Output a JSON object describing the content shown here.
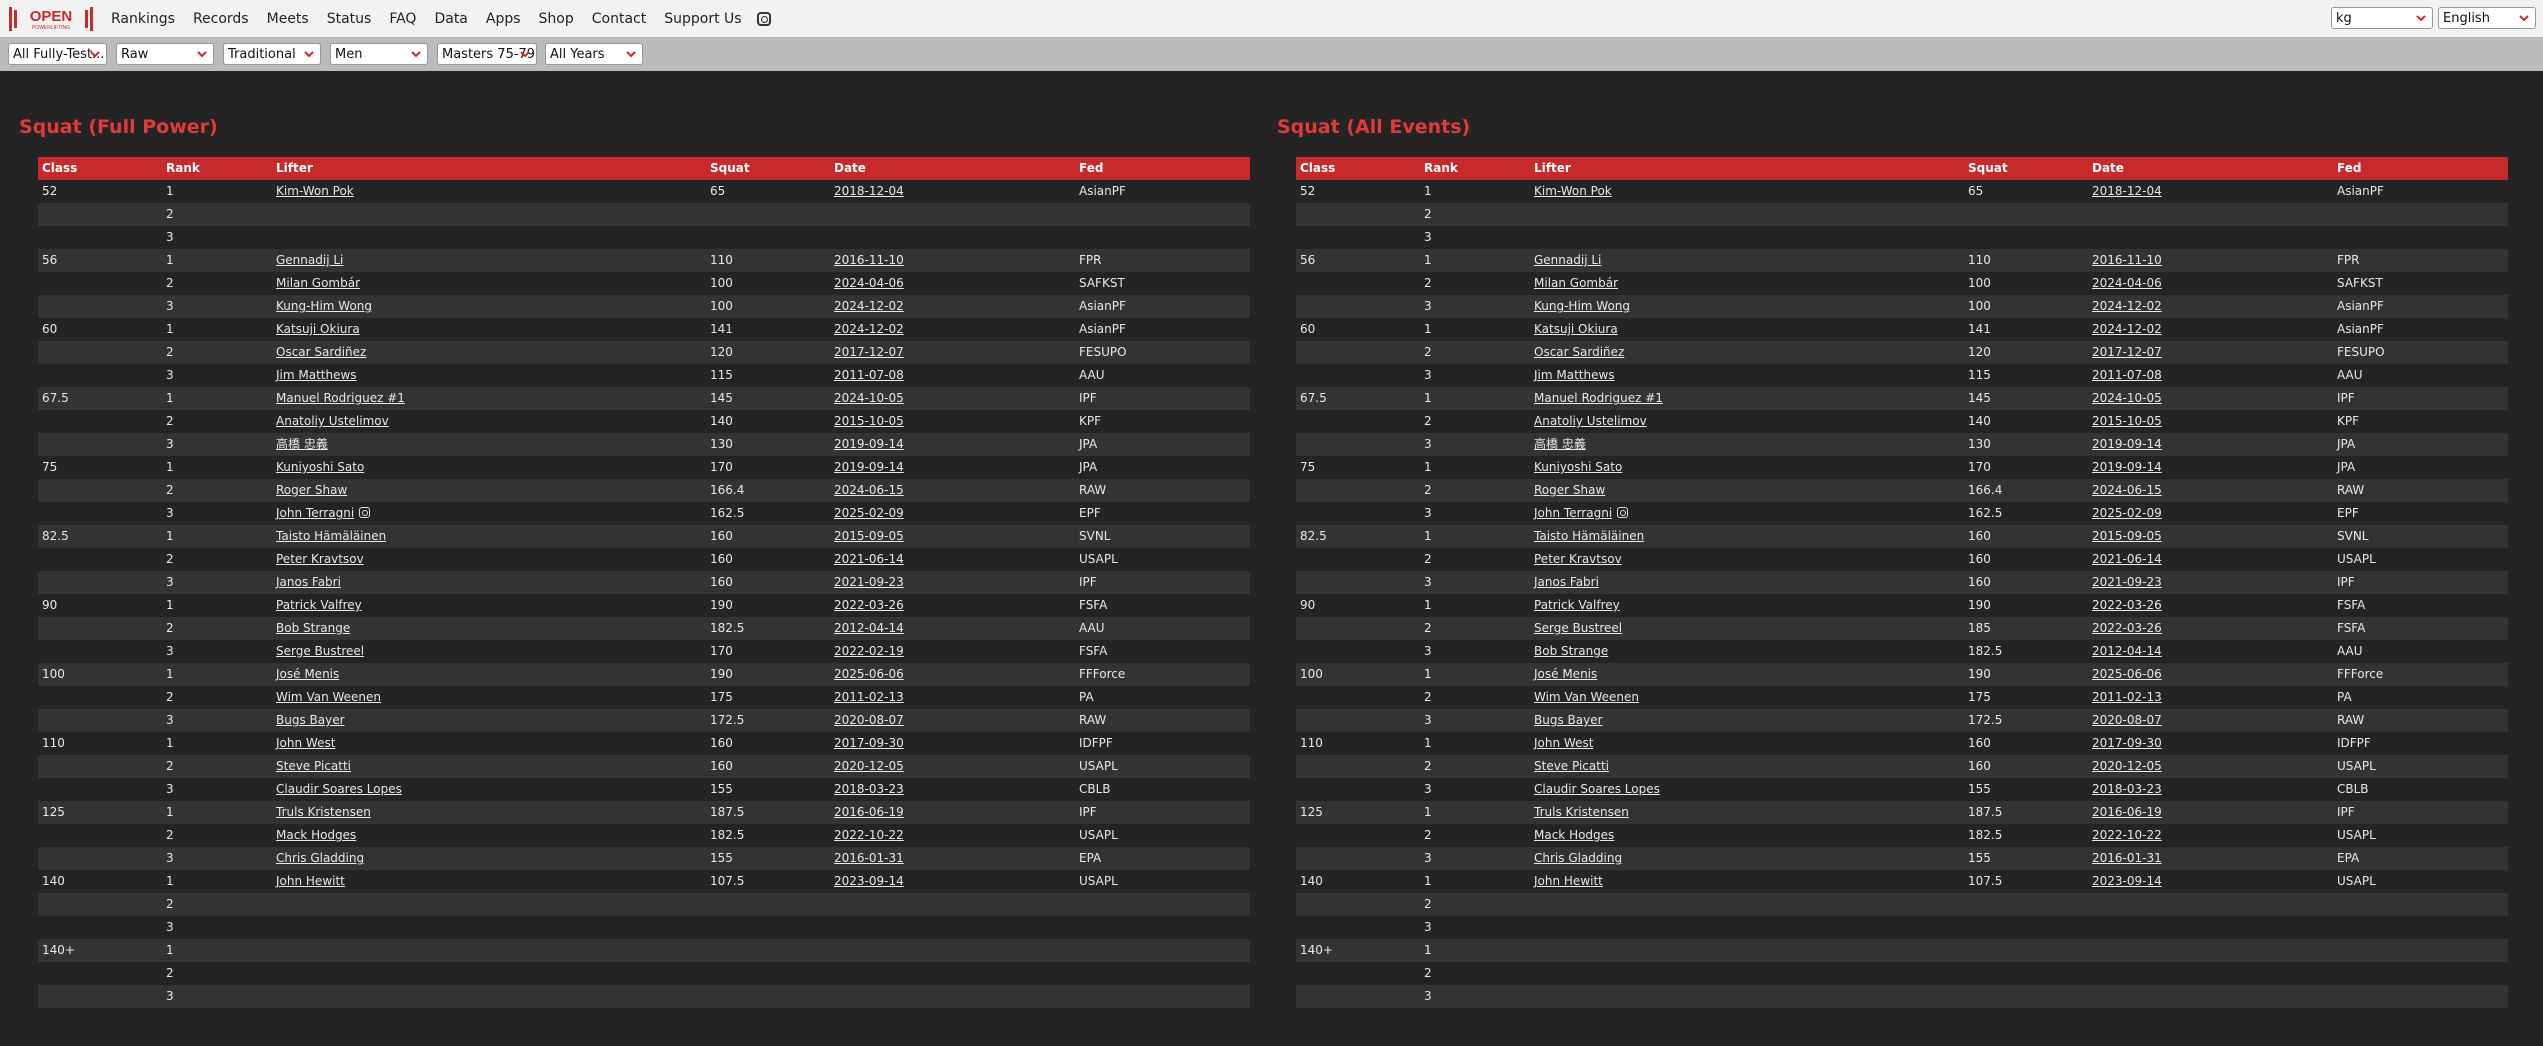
{
  "logo": {
    "main": "OPEN",
    "sub": "POWERLIFTING"
  },
  "nav": {
    "items": [
      "Rankings",
      "Records",
      "Meets",
      "Status",
      "FAQ",
      "Data",
      "Apps",
      "Shop",
      "Contact",
      "Support Us"
    ]
  },
  "units_select": "kg",
  "language_select": "English",
  "filters": [
    "All Fully-Test...",
    "Raw",
    "Traditional",
    "Men",
    "Masters 75-79",
    "All Years"
  ],
  "colors": {
    "accent": "#e03a3a",
    "header": "#c62a2a",
    "bg": "#242424",
    "row_alt": "#333333"
  },
  "columns": [
    "Class",
    "Rank",
    "Lifter",
    "Squat",
    "Date",
    "Fed"
  ],
  "panels": [
    {
      "title": "Squat (Full Power)",
      "rows": [
        {
          "class": "52",
          "rank": "1",
          "lifter": "Kim-Won Pok",
          "squat": "65",
          "date": "2018-12-04",
          "fed": "AsianPF"
        },
        {
          "class": "",
          "rank": "2",
          "lifter": "",
          "squat": "",
          "date": "",
          "fed": ""
        },
        {
          "class": "",
          "rank": "3",
          "lifter": "",
          "squat": "",
          "date": "",
          "fed": ""
        },
        {
          "class": "56",
          "rank": "1",
          "lifter": "Gennadij Li",
          "squat": "110",
          "date": "2016-11-10",
          "fed": "FPR"
        },
        {
          "class": "",
          "rank": "2",
          "lifter": "Milan Gombár",
          "squat": "100",
          "date": "2024-04-06",
          "fed": "SAFKST"
        },
        {
          "class": "",
          "rank": "3",
          "lifter": "Kung-Him Wong",
          "squat": "100",
          "date": "2024-12-02",
          "fed": "AsianPF"
        },
        {
          "class": "60",
          "rank": "1",
          "lifter": "Katsuji Okiura",
          "squat": "141",
          "date": "2024-12-02",
          "fed": "AsianPF"
        },
        {
          "class": "",
          "rank": "2",
          "lifter": "Oscar Sardiñez",
          "squat": "120",
          "date": "2017-12-07",
          "fed": "FESUPO"
        },
        {
          "class": "",
          "rank": "3",
          "lifter": "Jim Matthews",
          "squat": "115",
          "date": "2011-07-08",
          "fed": "AAU"
        },
        {
          "class": "67.5",
          "rank": "1",
          "lifter": "Manuel Rodriguez #1",
          "squat": "145",
          "date": "2024-10-05",
          "fed": "IPF"
        },
        {
          "class": "",
          "rank": "2",
          "lifter": "Anatoliy Ustelimov",
          "squat": "140",
          "date": "2015-10-05",
          "fed": "KPF"
        },
        {
          "class": "",
          "rank": "3",
          "lifter": "高橋 忠義",
          "squat": "130",
          "date": "2019-09-14",
          "fed": "JPA"
        },
        {
          "class": "75",
          "rank": "1",
          "lifter": "Kuniyoshi Sato",
          "squat": "170",
          "date": "2019-09-14",
          "fed": "JPA"
        },
        {
          "class": "",
          "rank": "2",
          "lifter": "Roger Shaw",
          "squat": "166.4",
          "date": "2024-06-15",
          "fed": "RAW"
        },
        {
          "class": "",
          "rank": "3",
          "lifter": "John Terragni",
          "squat": "162.5",
          "date": "2025-02-09",
          "fed": "EPF",
          "ig": true
        },
        {
          "class": "82.5",
          "rank": "1",
          "lifter": "Taisto Hämäläinen",
          "squat": "160",
          "date": "2015-09-05",
          "fed": "SVNL"
        },
        {
          "class": "",
          "rank": "2",
          "lifter": "Peter Kravtsov",
          "squat": "160",
          "date": "2021-06-14",
          "fed": "USAPL"
        },
        {
          "class": "",
          "rank": "3",
          "lifter": "Janos Fabri",
          "squat": "160",
          "date": "2021-09-23",
          "fed": "IPF"
        },
        {
          "class": "90",
          "rank": "1",
          "lifter": "Patrick Valfrey",
          "squat": "190",
          "date": "2022-03-26",
          "fed": "FSFA"
        },
        {
          "class": "",
          "rank": "2",
          "lifter": "Bob Strange",
          "squat": "182.5",
          "date": "2012-04-14",
          "fed": "AAU"
        },
        {
          "class": "",
          "rank": "3",
          "lifter": "Serge Bustreel",
          "squat": "170",
          "date": "2022-02-19",
          "fed": "FSFA"
        },
        {
          "class": "100",
          "rank": "1",
          "lifter": "José Menis",
          "squat": "190",
          "date": "2025-06-06",
          "fed": "FFForce"
        },
        {
          "class": "",
          "rank": "2",
          "lifter": "Wim Van Weenen",
          "squat": "175",
          "date": "2011-02-13",
          "fed": "PA"
        },
        {
          "class": "",
          "rank": "3",
          "lifter": "Bugs Bayer",
          "squat": "172.5",
          "date": "2020-08-07",
          "fed": "RAW"
        },
        {
          "class": "110",
          "rank": "1",
          "lifter": "John West",
          "squat": "160",
          "date": "2017-09-30",
          "fed": "IDFPF"
        },
        {
          "class": "",
          "rank": "2",
          "lifter": "Steve Picatti",
          "squat": "160",
          "date": "2020-12-05",
          "fed": "USAPL"
        },
        {
          "class": "",
          "rank": "3",
          "lifter": "Claudir Soares Lopes",
          "squat": "155",
          "date": "2018-03-23",
          "fed": "CBLB"
        },
        {
          "class": "125",
          "rank": "1",
          "lifter": "Truls Kristensen",
          "squat": "187.5",
          "date": "2016-06-19",
          "fed": "IPF"
        },
        {
          "class": "",
          "rank": "2",
          "lifter": "Mack Hodges",
          "squat": "182.5",
          "date": "2022-10-22",
          "fed": "USAPL"
        },
        {
          "class": "",
          "rank": "3",
          "lifter": "Chris Gladding",
          "squat": "155",
          "date": "2016-01-31",
          "fed": "EPA"
        },
        {
          "class": "140",
          "rank": "1",
          "lifter": "John Hewitt",
          "squat": "107.5",
          "date": "2023-09-14",
          "fed": "USAPL"
        },
        {
          "class": "",
          "rank": "2",
          "lifter": "",
          "squat": "",
          "date": "",
          "fed": ""
        },
        {
          "class": "",
          "rank": "3",
          "lifter": "",
          "squat": "",
          "date": "",
          "fed": ""
        },
        {
          "class": "140+",
          "rank": "1",
          "lifter": "",
          "squat": "",
          "date": "",
          "fed": ""
        },
        {
          "class": "",
          "rank": "2",
          "lifter": "",
          "squat": "",
          "date": "",
          "fed": ""
        },
        {
          "class": "",
          "rank": "3",
          "lifter": "",
          "squat": "",
          "date": "",
          "fed": ""
        }
      ]
    },
    {
      "title": "Squat (All Events)",
      "rows": [
        {
          "class": "52",
          "rank": "1",
          "lifter": "Kim-Won Pok",
          "squat": "65",
          "date": "2018-12-04",
          "fed": "AsianPF"
        },
        {
          "class": "",
          "rank": "2",
          "lifter": "",
          "squat": "",
          "date": "",
          "fed": ""
        },
        {
          "class": "",
          "rank": "3",
          "lifter": "",
          "squat": "",
          "date": "",
          "fed": ""
        },
        {
          "class": "56",
          "rank": "1",
          "lifter": "Gennadij Li",
          "squat": "110",
          "date": "2016-11-10",
          "fed": "FPR"
        },
        {
          "class": "",
          "rank": "2",
          "lifter": "Milan Gombár",
          "squat": "100",
          "date": "2024-04-06",
          "fed": "SAFKST"
        },
        {
          "class": "",
          "rank": "3",
          "lifter": "Kung-Him Wong",
          "squat": "100",
          "date": "2024-12-02",
          "fed": "AsianPF"
        },
        {
          "class": "60",
          "rank": "1",
          "lifter": "Katsuji Okiura",
          "squat": "141",
          "date": "2024-12-02",
          "fed": "AsianPF"
        },
        {
          "class": "",
          "rank": "2",
          "lifter": "Oscar Sardiñez",
          "squat": "120",
          "date": "2017-12-07",
          "fed": "FESUPO"
        },
        {
          "class": "",
          "rank": "3",
          "lifter": "Jim Matthews",
          "squat": "115",
          "date": "2011-07-08",
          "fed": "AAU"
        },
        {
          "class": "67.5",
          "rank": "1",
          "lifter": "Manuel Rodriguez #1",
          "squat": "145",
          "date": "2024-10-05",
          "fed": "IPF"
        },
        {
          "class": "",
          "rank": "2",
          "lifter": "Anatoliy Ustelimov",
          "squat": "140",
          "date": "2015-10-05",
          "fed": "KPF"
        },
        {
          "class": "",
          "rank": "3",
          "lifter": "高橋 忠義",
          "squat": "130",
          "date": "2019-09-14",
          "fed": "JPA"
        },
        {
          "class": "75",
          "rank": "1",
          "lifter": "Kuniyoshi Sato",
          "squat": "170",
          "date": "2019-09-14",
          "fed": "JPA"
        },
        {
          "class": "",
          "rank": "2",
          "lifter": "Roger Shaw",
          "squat": "166.4",
          "date": "2024-06-15",
          "fed": "RAW"
        },
        {
          "class": "",
          "rank": "3",
          "lifter": "John Terragni",
          "squat": "162.5",
          "date": "2025-02-09",
          "fed": "EPF",
          "ig": true
        },
        {
          "class": "82.5",
          "rank": "1",
          "lifter": "Taisto Hämäläinen",
          "squat": "160",
          "date": "2015-09-05",
          "fed": "SVNL"
        },
        {
          "class": "",
          "rank": "2",
          "lifter": "Peter Kravtsov",
          "squat": "160",
          "date": "2021-06-14",
          "fed": "USAPL"
        },
        {
          "class": "",
          "rank": "3",
          "lifter": "Janos Fabri",
          "squat": "160",
          "date": "2021-09-23",
          "fed": "IPF"
        },
        {
          "class": "90",
          "rank": "1",
          "lifter": "Patrick Valfrey",
          "squat": "190",
          "date": "2022-03-26",
          "fed": "FSFA"
        },
        {
          "class": "",
          "rank": "2",
          "lifter": "Serge Bustreel",
          "squat": "185",
          "date": "2022-03-26",
          "fed": "FSFA"
        },
        {
          "class": "",
          "rank": "3",
          "lifter": "Bob Strange",
          "squat": "182.5",
          "date": "2012-04-14",
          "fed": "AAU"
        },
        {
          "class": "100",
          "rank": "1",
          "lifter": "José Menis",
          "squat": "190",
          "date": "2025-06-06",
          "fed": "FFForce"
        },
        {
          "class": "",
          "rank": "2",
          "lifter": "Wim Van Weenen",
          "squat": "175",
          "date": "2011-02-13",
          "fed": "PA"
        },
        {
          "class": "",
          "rank": "3",
          "lifter": "Bugs Bayer",
          "squat": "172.5",
          "date": "2020-08-07",
          "fed": "RAW"
        },
        {
          "class": "110",
          "rank": "1",
          "lifter": "John West",
          "squat": "160",
          "date": "2017-09-30",
          "fed": "IDFPF"
        },
        {
          "class": "",
          "rank": "2",
          "lifter": "Steve Picatti",
          "squat": "160",
          "date": "2020-12-05",
          "fed": "USAPL"
        },
        {
          "class": "",
          "rank": "3",
          "lifter": "Claudir Soares Lopes",
          "squat": "155",
          "date": "2018-03-23",
          "fed": "CBLB"
        },
        {
          "class": "125",
          "rank": "1",
          "lifter": "Truls Kristensen",
          "squat": "187.5",
          "date": "2016-06-19",
          "fed": "IPF"
        },
        {
          "class": "",
          "rank": "2",
          "lifter": "Mack Hodges",
          "squat": "182.5",
          "date": "2022-10-22",
          "fed": "USAPL"
        },
        {
          "class": "",
          "rank": "3",
          "lifter": "Chris Gladding",
          "squat": "155",
          "date": "2016-01-31",
          "fed": "EPA"
        },
        {
          "class": "140",
          "rank": "1",
          "lifter": "John Hewitt",
          "squat": "107.5",
          "date": "2023-09-14",
          "fed": "USAPL"
        },
        {
          "class": "",
          "rank": "2",
          "lifter": "",
          "squat": "",
          "date": "",
          "fed": ""
        },
        {
          "class": "",
          "rank": "3",
          "lifter": "",
          "squat": "",
          "date": "",
          "fed": ""
        },
        {
          "class": "140+",
          "rank": "1",
          "lifter": "",
          "squat": "",
          "date": "",
          "fed": ""
        },
        {
          "class": "",
          "rank": "2",
          "lifter": "",
          "squat": "",
          "date": "",
          "fed": ""
        },
        {
          "class": "",
          "rank": "3",
          "lifter": "",
          "squat": "",
          "date": "",
          "fed": ""
        }
      ]
    }
  ]
}
